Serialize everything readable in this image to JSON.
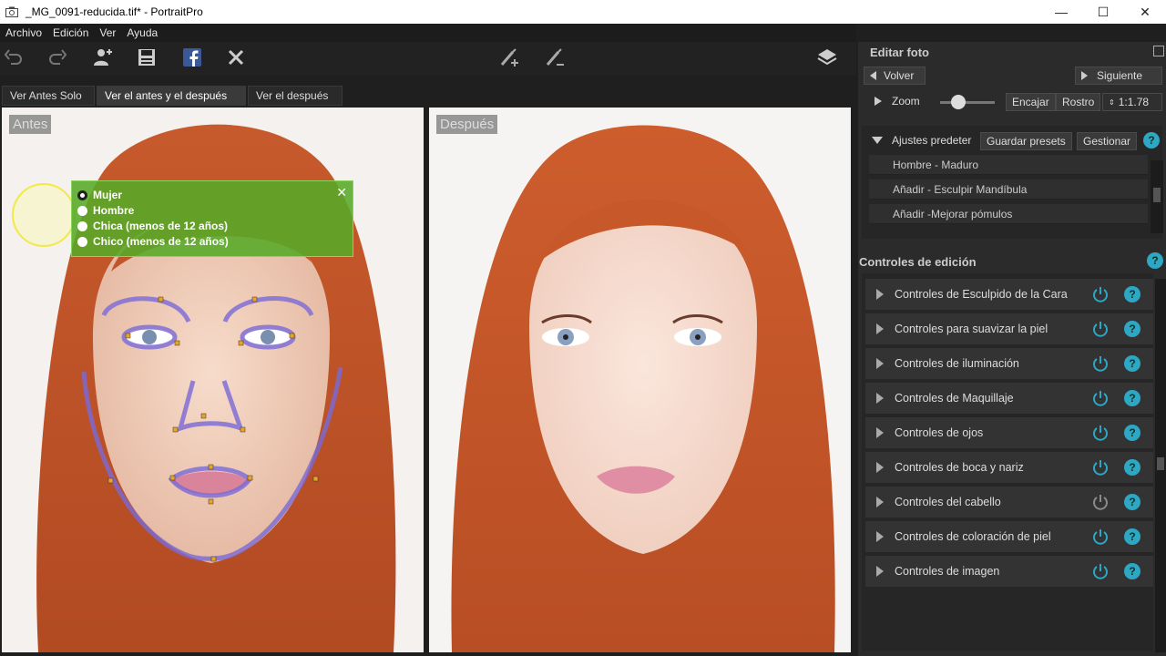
{
  "window": {
    "title": "_MG_0091-reducida.tif* - PortraitPro",
    "minimize": "—",
    "maximize": "☐",
    "close": "✕"
  },
  "menu": [
    "Archivo",
    "Edición",
    "Ver",
    "Ayuda"
  ],
  "tabs": {
    "before_only": "Ver Antes Solo",
    "before_after": "Ver el antes y el después",
    "after": "Ver el después"
  },
  "viewers": {
    "before_label": "Antes",
    "after_label": "Después"
  },
  "gender_popup": {
    "options": [
      "Mujer",
      "Hombre",
      "Chica (menos de 12 años)",
      "Chico (menos de 12 años)"
    ],
    "selected": "Mujer",
    "close": "✕"
  },
  "panel": {
    "header": "Editar foto",
    "back": "Volver",
    "next": "Siguiente",
    "zoom_label": "Zoom",
    "zoom_slider": 0.2,
    "fit": "Encajar",
    "face": "Rostro",
    "zoom_value": "1:1.78",
    "presets_label": "Ajustes predeter",
    "save_presets": "Guardar presets",
    "manage": "Gestionar",
    "presets": [
      "Hombre - Maduro",
      "Añadir - Esculpir Mandíbula",
      "Añadir -Mejorar pómulos"
    ],
    "controls_header": "Controles de edición",
    "controls": [
      "Controles de Esculpido de la Cara",
      "Controles para suavizar la piel",
      "Controles de iluminación",
      "Controles de Maquillaje",
      "Controles de ojos",
      "Controles de boca y nariz",
      "Controles del cabello",
      "Controles de coloración de piel",
      "Controles de imagen"
    ],
    "help": "?"
  },
  "colors": {
    "accent": "#2ea7c4",
    "popup": "#5aab2e",
    "hair": "#c9582a",
    "skin": "#f1cdb8",
    "outline": "#7a6ad8"
  }
}
